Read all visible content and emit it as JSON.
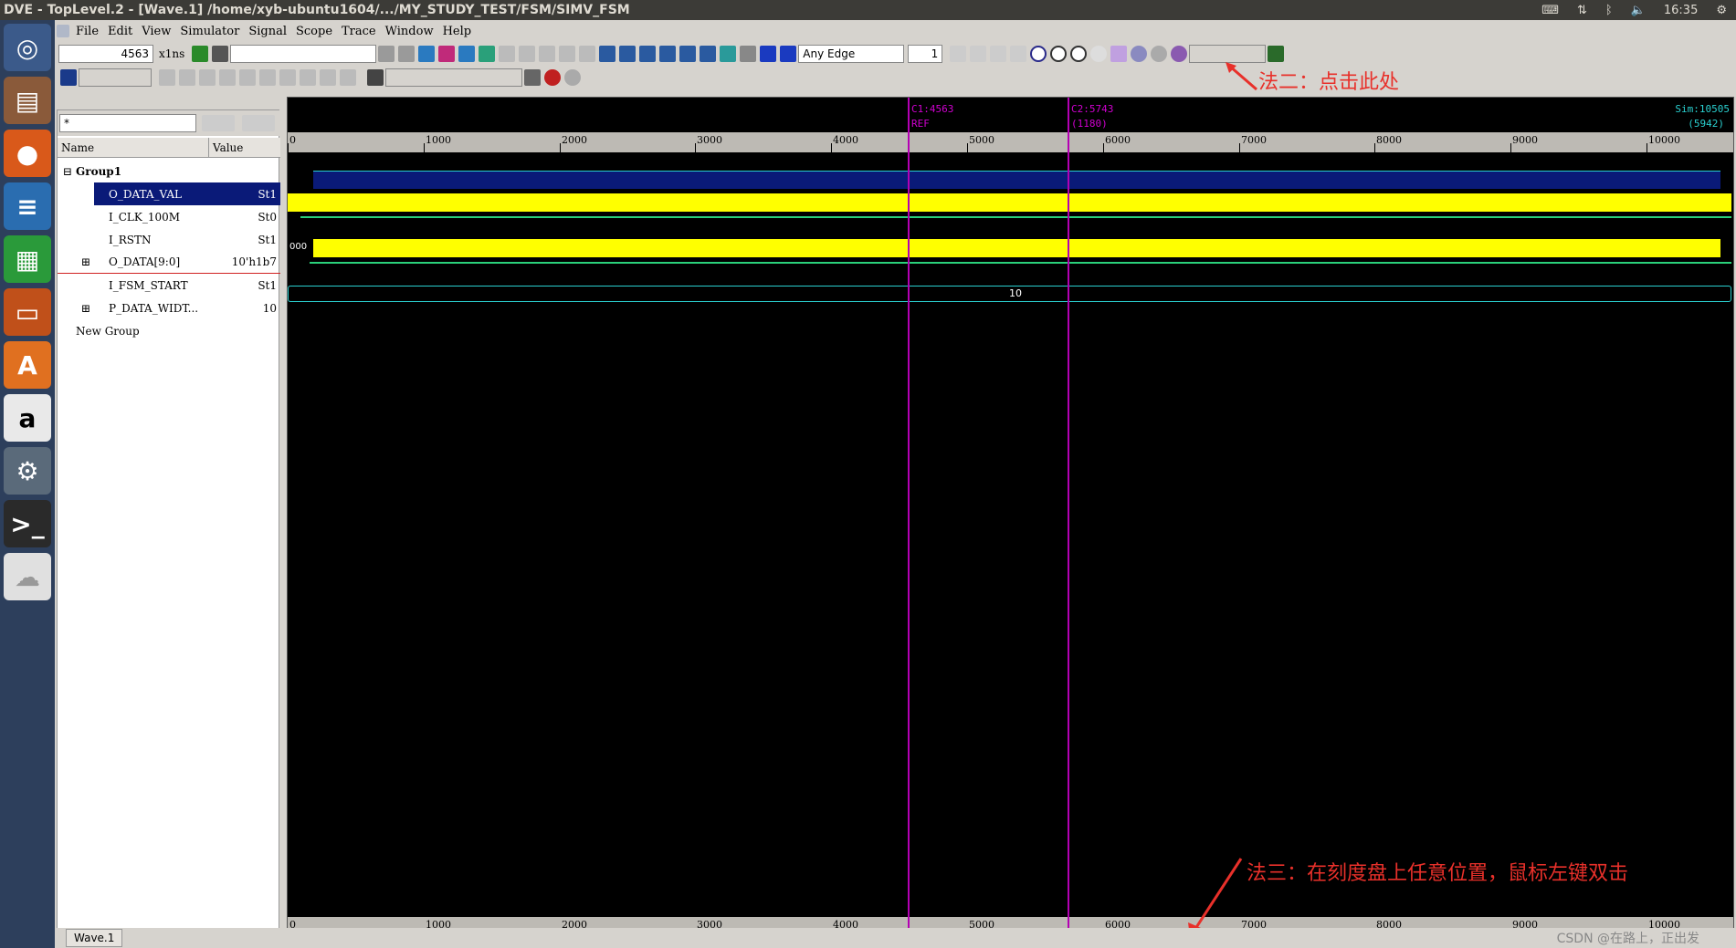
{
  "window": {
    "title": "DVE - TopLevel.2 - [Wave.1]  /home/xyb-ubuntu1604/.../MY_STUDY_TEST/FSM/SIMV_FSM",
    "clock": "16:35"
  },
  "menu": [
    "File",
    "Edit",
    "View",
    "Simulator",
    "Signal",
    "Scope",
    "Trace",
    "Window",
    "Help"
  ],
  "toolbar": {
    "time_value": "4563",
    "time_unit": "x1ns",
    "edge_select": "Any Edge",
    "edge_count": "1",
    "filter_value": "*"
  },
  "signal_pane": {
    "col_name": "Name",
    "col_value": "Value",
    "group": "Group1",
    "new_group": "New Group",
    "signals": [
      {
        "name": "O_DATA_VAL",
        "value": "St1"
      },
      {
        "name": "I_CLK_100M",
        "value": "St0"
      },
      {
        "name": "I_RSTN",
        "value": "St1"
      },
      {
        "name": "O_DATA[9:0]",
        "value": "10'h1b7"
      },
      {
        "name": "I_FSM_START",
        "value": "St1"
      },
      {
        "name": "P_DATA_WIDT...",
        "value": "10"
      }
    ]
  },
  "wave": {
    "cursor1": {
      "label": "C1:4563",
      "sub": "REF",
      "time": 4563
    },
    "cursor2": {
      "label": "C2:5743",
      "sub": "(1180)",
      "time": 5743
    },
    "sim": {
      "label": "Sim:10505",
      "sub": "(5942)"
    },
    "ruler_ticks": [
      "0",
      "1000",
      "2000",
      "3000",
      "4000",
      "5000",
      "6000",
      "7000",
      "8000",
      "9000",
      "10000"
    ],
    "bus_start_value": "000",
    "param_value": "10",
    "time_max": 10505
  },
  "annotations": {
    "a1": "法二：点击此处",
    "a2": "法三：在刻度盘上任意位置，鼠标左键双击"
  },
  "status": {
    "tab": "Wave.1"
  },
  "watermark": "CSDN @在路上，正出发"
}
